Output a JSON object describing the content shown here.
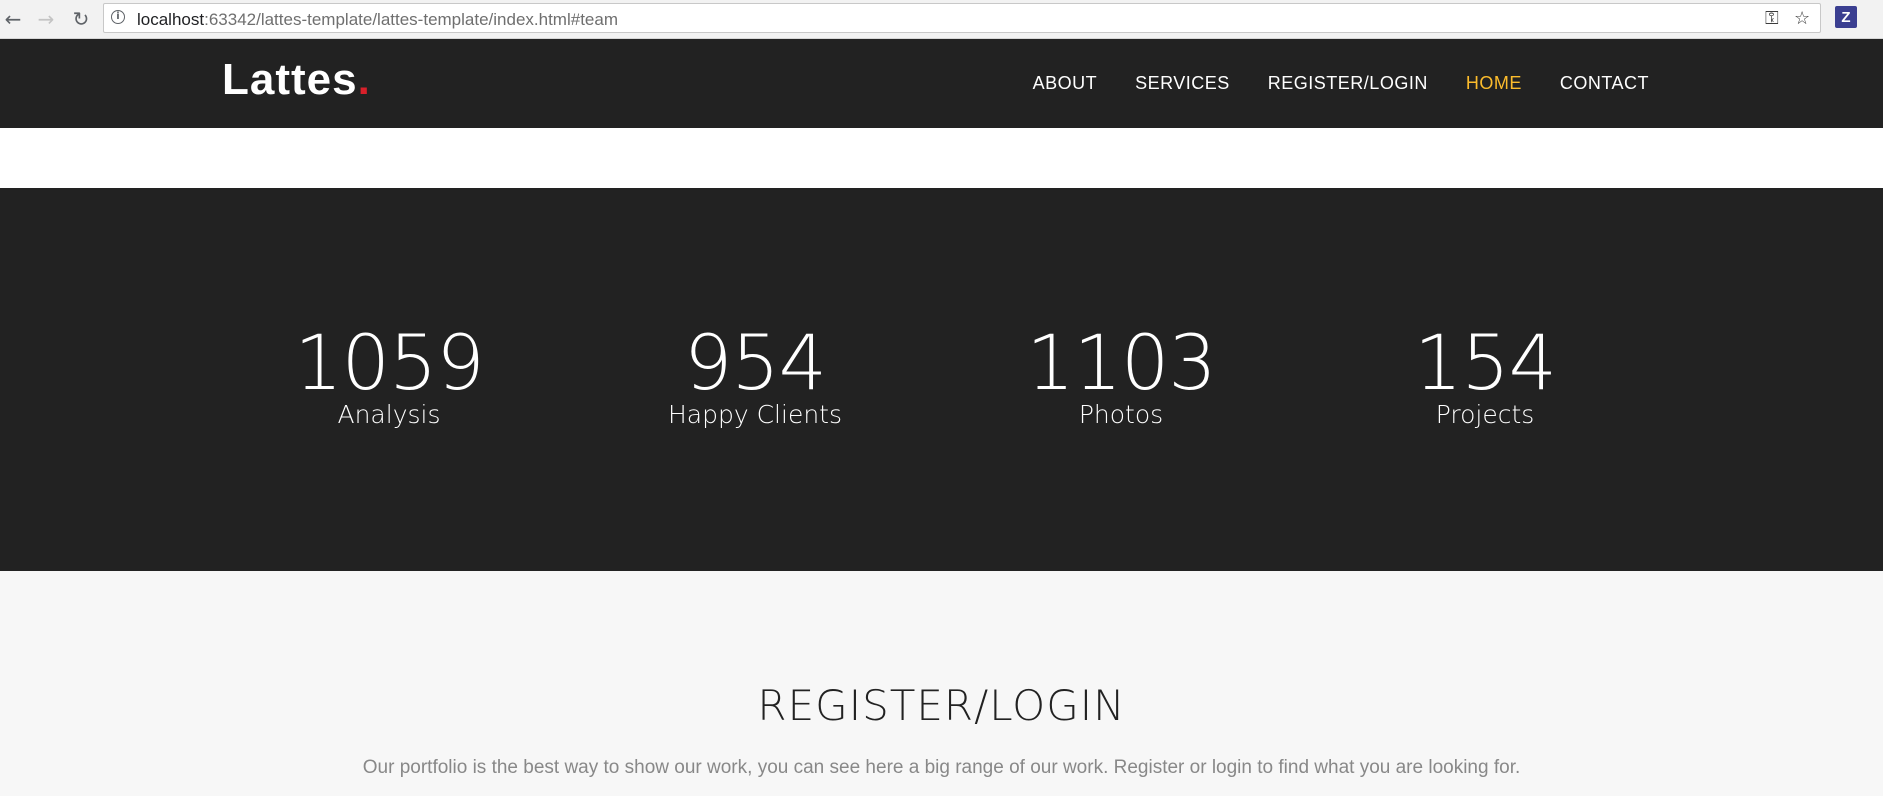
{
  "browser": {
    "url_host": "localhost",
    "url_rest": ":63342/lattes-template/lattes-template/index.html#team",
    "back_icon": "arrow-left-icon",
    "forward_icon": "arrow-right-icon",
    "reload_icon": "reload-icon",
    "extension_label": "Z"
  },
  "header": {
    "logo": "Lattes",
    "logo_dot": ".",
    "nav": [
      {
        "label": "ABOUT"
      },
      {
        "label": "SERVICES"
      },
      {
        "label": "REGISTER/LOGIN"
      },
      {
        "label": "HOME"
      },
      {
        "label": "CONTACT"
      }
    ],
    "active_color": "#fcbc2c"
  },
  "stats": [
    {
      "number": "1059",
      "label": "Analysis"
    },
    {
      "number": "954",
      "label": "Happy Clients"
    },
    {
      "number": "1103",
      "label": "Photos"
    },
    {
      "number": "154",
      "label": "Projects"
    }
  ],
  "register": {
    "title": "REGISTER/LOGIN",
    "description": "Our portfolio is the best way to show our work, you can see here a big range of our work. Register or login to find what you are looking for."
  },
  "colors": {
    "dark_bg": "#222222",
    "light_bg": "#f7f7f7",
    "accent": "#fcbc2c",
    "logo_dot": "#d8202a"
  }
}
